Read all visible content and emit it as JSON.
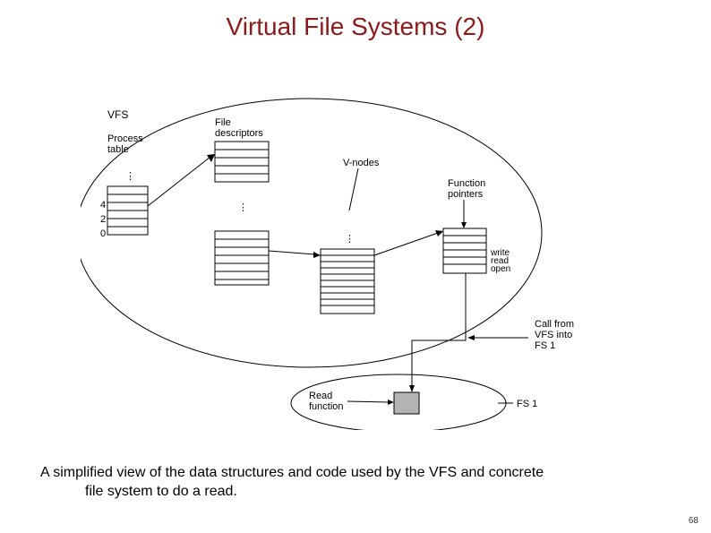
{
  "title": "Virtual File Systems (2)",
  "caption_line1": "A simplified view of the data structures and code used by the VFS and concrete",
  "caption_line2": "file system to do a read.",
  "page_number": "68",
  "labels": {
    "vfs": "VFS",
    "process_table_l1": "Process",
    "process_table_l2": "table",
    "file_desc_l1": "File",
    "file_desc_l2": "descriptors",
    "vnodes": "V-nodes",
    "func_ptr_l1": "Function",
    "func_ptr_l2": "pointers",
    "write": "write",
    "read": "read",
    "open": "open",
    "call_l1": "Call from",
    "call_l2": "VFS into",
    "call_l3": "FS 1",
    "read_func_l1": "Read",
    "read_func_l2": "function",
    "fs1": "FS 1",
    "pt_4": "4",
    "pt_2": "2",
    "pt_0": "0"
  }
}
